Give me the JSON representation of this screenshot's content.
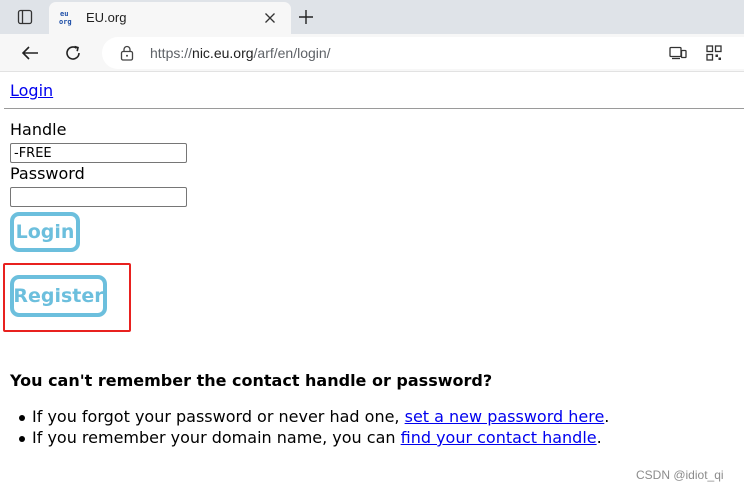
{
  "browser": {
    "tab": {
      "title": "EU.org",
      "favicon_text": "eu org"
    },
    "address": {
      "prefix": "https://",
      "host": "nic.eu.org",
      "path": "/arf/en/login/"
    }
  },
  "page": {
    "top_link": "Login",
    "handle_label": "Handle",
    "handle_value": "-FREE",
    "password_label": "Password",
    "password_value": "",
    "login_button": "Login",
    "register_button": "Register",
    "help_heading": "You can't remember the contact handle or password?",
    "help_items": [
      {
        "before": "If you forgot your password or never had one, ",
        "link": "set a new password here",
        "after": "."
      },
      {
        "before": "If you remember your domain name, you can ",
        "link": "find your contact handle",
        "after": "."
      }
    ]
  },
  "watermark": "CSDN @idiot_qi",
  "colors": {
    "button_accent": "#6cbfdd",
    "highlight": "#e8211f",
    "link": "#0000ee"
  }
}
